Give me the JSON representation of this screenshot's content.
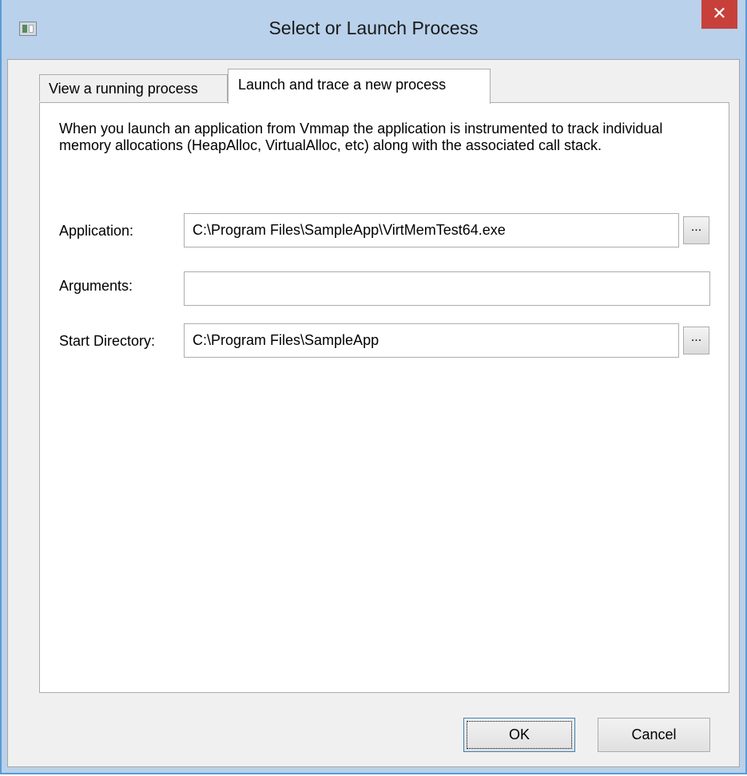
{
  "window": {
    "title": "Select or Launch Process",
    "close_glyph": "✕",
    "icon": "app-window-icon"
  },
  "tabs": [
    {
      "label": "View a running process",
      "active": false
    },
    {
      "label": "Launch and trace a new process",
      "active": true
    }
  ],
  "panel": {
    "description": "When you launch an application from Vmmap the application is instrumented to track individual memory allocations (HeapAlloc, VirtualAlloc, etc) along with the associated call stack.",
    "fields": {
      "application": {
        "label": "Application:",
        "value": "C:\\Program Files\\SampleApp\\VirtMemTest64.exe",
        "browse_label": "..."
      },
      "arguments": {
        "label": "Arguments:",
        "value": ""
      },
      "start_directory": {
        "label": "Start Directory:",
        "value": "C:\\Program Files\\SampleApp",
        "browse_label": "..."
      }
    }
  },
  "buttons": {
    "ok": "OK",
    "cancel": "Cancel"
  },
  "colors": {
    "titlebar": "#b9d1ea",
    "close": "#c7403a",
    "dialog_bg": "#f0f0f0",
    "panel_bg": "#ffffff"
  }
}
